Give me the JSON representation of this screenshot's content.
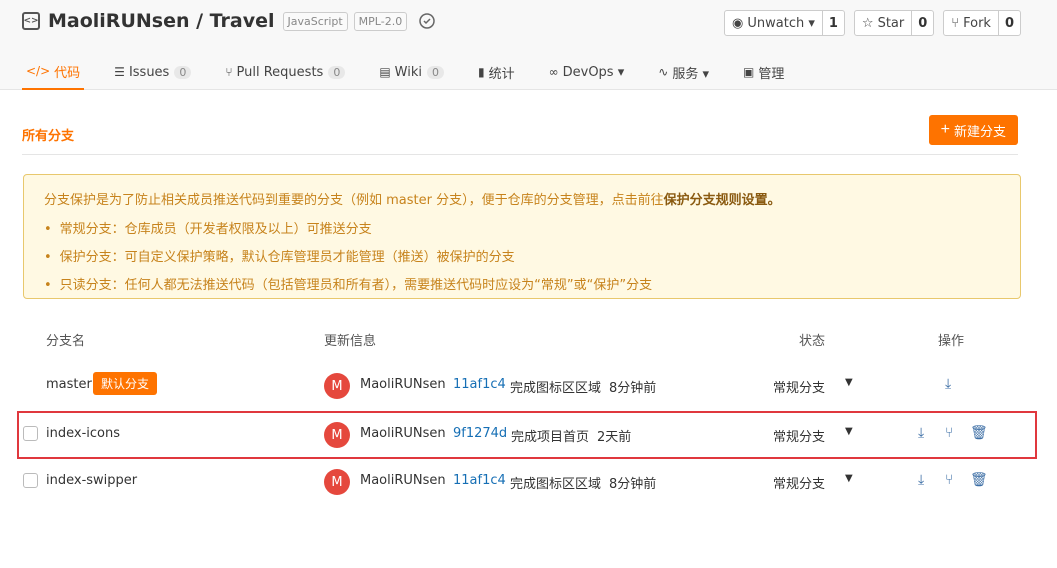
{
  "repo": {
    "owner": "MaoliRUNsen",
    "separator": " / ",
    "name": "Travel",
    "tags": [
      "JavaScript",
      "MPL-2.0"
    ]
  },
  "actions": [
    {
      "label": "Unwatch ▾",
      "count": "1",
      "icon": "eye-icon"
    },
    {
      "label": "Star",
      "count": "0",
      "icon": "star-icon"
    },
    {
      "label": "Fork",
      "count": "0",
      "icon": "fork-icon"
    }
  ],
  "tabs": [
    {
      "label": "代码",
      "icon": "code-icon",
      "glyph": "</>",
      "count": null,
      "active": true
    },
    {
      "label": "Issues",
      "icon": "issues-icon",
      "glyph": "☰",
      "count": "0"
    },
    {
      "label": "Pull Requests",
      "icon": "pull-request-icon",
      "glyph": "⑂",
      "count": "0"
    },
    {
      "label": "Wiki",
      "icon": "wiki-icon",
      "glyph": "▤",
      "count": "0"
    },
    {
      "label": "统计",
      "icon": "stats-icon",
      "glyph": "▮",
      "count": null
    },
    {
      "label": "DevOps ▾",
      "icon": "devops-icon",
      "glyph": "∞",
      "count": null
    },
    {
      "label": "服务 ▾",
      "icon": "service-icon",
      "glyph": "∿",
      "count": null
    },
    {
      "label": "管理",
      "icon": "manage-icon",
      "glyph": "▣",
      "count": null
    }
  ],
  "section": {
    "title": "所有分支",
    "new_button": "新建分支"
  },
  "notice": {
    "intro": "分支保护是为了防止相关成员推送代码到重要的分支（例如 master 分支），便于仓库的分支管理，点击前往",
    "link": "保护分支规则设置。",
    "items": [
      "常规分支：仓库成员（开发者权限及以上）可推送分支",
      "保护分支：可自定义保护策略，默认仓库管理员才能管理（推送）被保护的分支",
      "只读分支：任何人都无法推送代码（包括管理员和所有者），需要推送代码时应设为“常规”或“保护”分支"
    ]
  },
  "table": {
    "headers": {
      "name": "分支名",
      "info": "更新信息",
      "status": "状态",
      "ops": "操作"
    },
    "rows": [
      {
        "name": "master",
        "default_tag": "默认分支",
        "avatar": "M",
        "author": "MaoliRUNsen",
        "commit": "11af1c4",
        "message": "完成图标区区域",
        "time": "8分钟前",
        "status": "常规分支"
      },
      {
        "name": "index-icons",
        "avatar": "M",
        "author": "MaoliRUNsen",
        "commit": "9f1274d",
        "message": "完成项目首页",
        "time": "2天前",
        "status": "常规分支"
      },
      {
        "name": "index-swipper",
        "avatar": "M",
        "author": "MaoliRUNsen",
        "commit": "11af1c4",
        "message": "完成图标区区域",
        "time": "8分钟前",
        "status": "常规分支"
      }
    ]
  },
  "colors": {
    "accent": "#fe7300",
    "link": "#166fb5",
    "avatar": "#e5483d",
    "highlight": "#e0383e"
  }
}
